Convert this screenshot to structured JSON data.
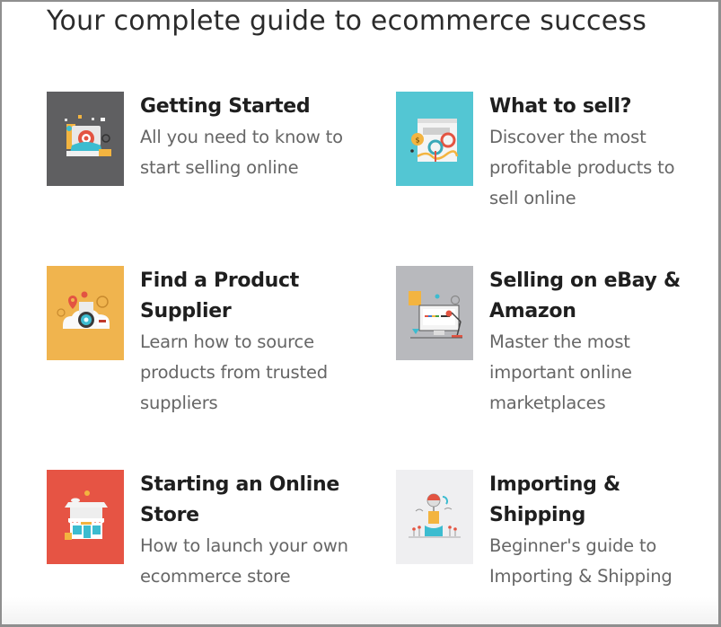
{
  "page": {
    "title": "Your complete guide to ecommerce success"
  },
  "cards": [
    {
      "title": "Getting Started",
      "description": "All you need to know to start selling online",
      "icon": "laptop-target-icon",
      "thumb_color": "#5f5f61"
    },
    {
      "title": "What to sell?",
      "description": "Discover the most profitable products to sell online",
      "icon": "gears-chart-icon",
      "thumb_color": "#53c6d3"
    },
    {
      "title": "Find a Product Supplier",
      "description": "Learn how to source products from trusted suppliers",
      "icon": "magnifier-supplier-icon",
      "thumb_color": "#f0b44e"
    },
    {
      "title": "Selling on eBay & Amazon",
      "description": "Master the most important online marketplaces",
      "icon": "desktop-marketplace-icon",
      "thumb_color": "#b8b9bd"
    },
    {
      "title": "Starting an Online Store",
      "description": "How to launch your own ecommerce store",
      "icon": "storefront-icon",
      "thumb_color": "#e65444"
    },
    {
      "title": "Importing & Shipping",
      "description": "Beginner's guide to Importing & Shipping",
      "icon": "package-shipping-icon",
      "thumb_color": "#efeff1"
    }
  ]
}
